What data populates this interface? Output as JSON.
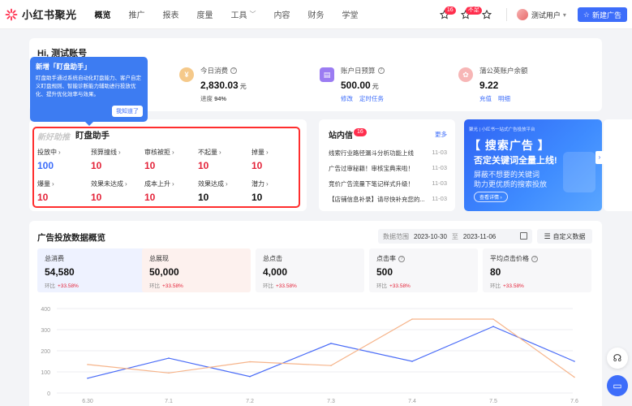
{
  "app": {
    "name": "小红书聚光"
  },
  "nav": {
    "items": [
      {
        "label": "概览",
        "active": true
      },
      {
        "label": "推广"
      },
      {
        "label": "报表"
      },
      {
        "label": "度量"
      },
      {
        "label": "工具",
        "caret": "﹀"
      },
      {
        "label": "内容"
      },
      {
        "label": "财务"
      },
      {
        "label": "学堂"
      }
    ]
  },
  "topright": {
    "badge1": "16",
    "badge2": "不足",
    "user": "测试用户",
    "new_ad": "新建广告"
  },
  "account": {
    "greeting": "Hi, 测试账号",
    "today": {
      "label": "今日消费",
      "value": "2,830.03",
      "unit": "元",
      "sub_label": "进度",
      "sub_value": "94%"
    },
    "budget": {
      "label": "账户日预算",
      "value": "500.00",
      "unit": "元",
      "link1": "修改",
      "link2": "定时任务"
    },
    "balance": {
      "label": "蒲公英账户余额",
      "value": "9.22",
      "link1": "充值",
      "link2": "明细"
    }
  },
  "tip": {
    "title": "新增「盯盘助手」",
    "text": "盯盘助手通过系统自动化盯盘能力、客户自定义盯盘规则、智能诊断能力辅助进行投放优化、提升优化效率与效果。",
    "button": "我知道了"
  },
  "helper": {
    "title_fade": "新好助推",
    "title": "盯盘助手",
    "cells": [
      {
        "label": "投放中",
        "value": "100",
        "color": "blue"
      },
      {
        "label": "预算撞线",
        "value": "10",
        "color": "red"
      },
      {
        "label": "审核被拒",
        "value": "10",
        "color": "red"
      },
      {
        "label": "不起量",
        "value": "10",
        "color": "red"
      },
      {
        "label": "掉量",
        "value": "10",
        "color": "red"
      },
      {
        "label": "爆量",
        "value": "10",
        "color": "red"
      },
      {
        "label": "效果未达成",
        "value": "10",
        "color": "red"
      },
      {
        "label": "成本上升",
        "value": "10",
        "color": "red"
      },
      {
        "label": "效果达成",
        "value": "10",
        "color": "black"
      },
      {
        "label": "潜力",
        "value": "10",
        "color": "black"
      }
    ]
  },
  "inbox": {
    "title": "站内信",
    "badge": "16",
    "more": "更多",
    "messages": [
      {
        "text": "线索行业路径漏斗分析功能上线",
        "date": "11-03"
      },
      {
        "text": "广告过审秘籍！审核宝典来啦！",
        "date": "11-03"
      },
      {
        "text": "竞价广告流量下笔记样式升级！",
        "date": "11-03"
      },
      {
        "text": "【店铺信息补录】请尽快补充您的...",
        "date": "11-03"
      }
    ]
  },
  "banner": {
    "top": "聚光 | 小红书一站式广告投放平台",
    "h1": "【 搜索广告 】",
    "h2": "否定关键词全量上线!",
    "line1": "屏蔽不想要的关键词",
    "line2": "助力更优质的搜索投放",
    "cta": "查看详情 ›"
  },
  "overview": {
    "title": "广告投放数据概览",
    "range_label": "数据范围",
    "start": "2023-10-30",
    "sep": "至",
    "end": "2023-11-06",
    "custom": "自定义数据",
    "kpis": [
      {
        "label": "总消费",
        "value": "54,580",
        "sub": "环比",
        "delta": "+33.58%",
        "style": "sel1",
        "q": false
      },
      {
        "label": "总展现",
        "value": "50,000",
        "sub": "环比",
        "delta": "+33.58%",
        "style": "sel2",
        "q": false
      },
      {
        "label": "总点击",
        "value": "4,000",
        "sub": "环比",
        "delta": "+33.58%",
        "style": "plain",
        "q": false
      },
      {
        "label": "点击率",
        "value": "500",
        "sub": "环比",
        "delta": "+33.58%",
        "style": "plain",
        "q": true
      },
      {
        "label": "平均点击价格",
        "value": "80",
        "sub": "环比",
        "delta": "+33.58%",
        "style": "plain",
        "q": true
      }
    ]
  },
  "chart_data": {
    "type": "line",
    "categories": [
      "6.30",
      "7.1",
      "7.2",
      "7.3",
      "7.4",
      "7.5",
      "7.6"
    ],
    "ylim": [
      0,
      400
    ],
    "yticks": [
      0,
      100,
      200,
      300,
      400
    ],
    "series": [
      {
        "values": [
          70,
          165,
          78,
          235,
          150,
          315,
          150
        ],
        "color": "#4a6cf7"
      },
      {
        "values": [
          135,
          95,
          148,
          130,
          350,
          350,
          75
        ],
        "color": "#f6b48a"
      }
    ]
  }
}
